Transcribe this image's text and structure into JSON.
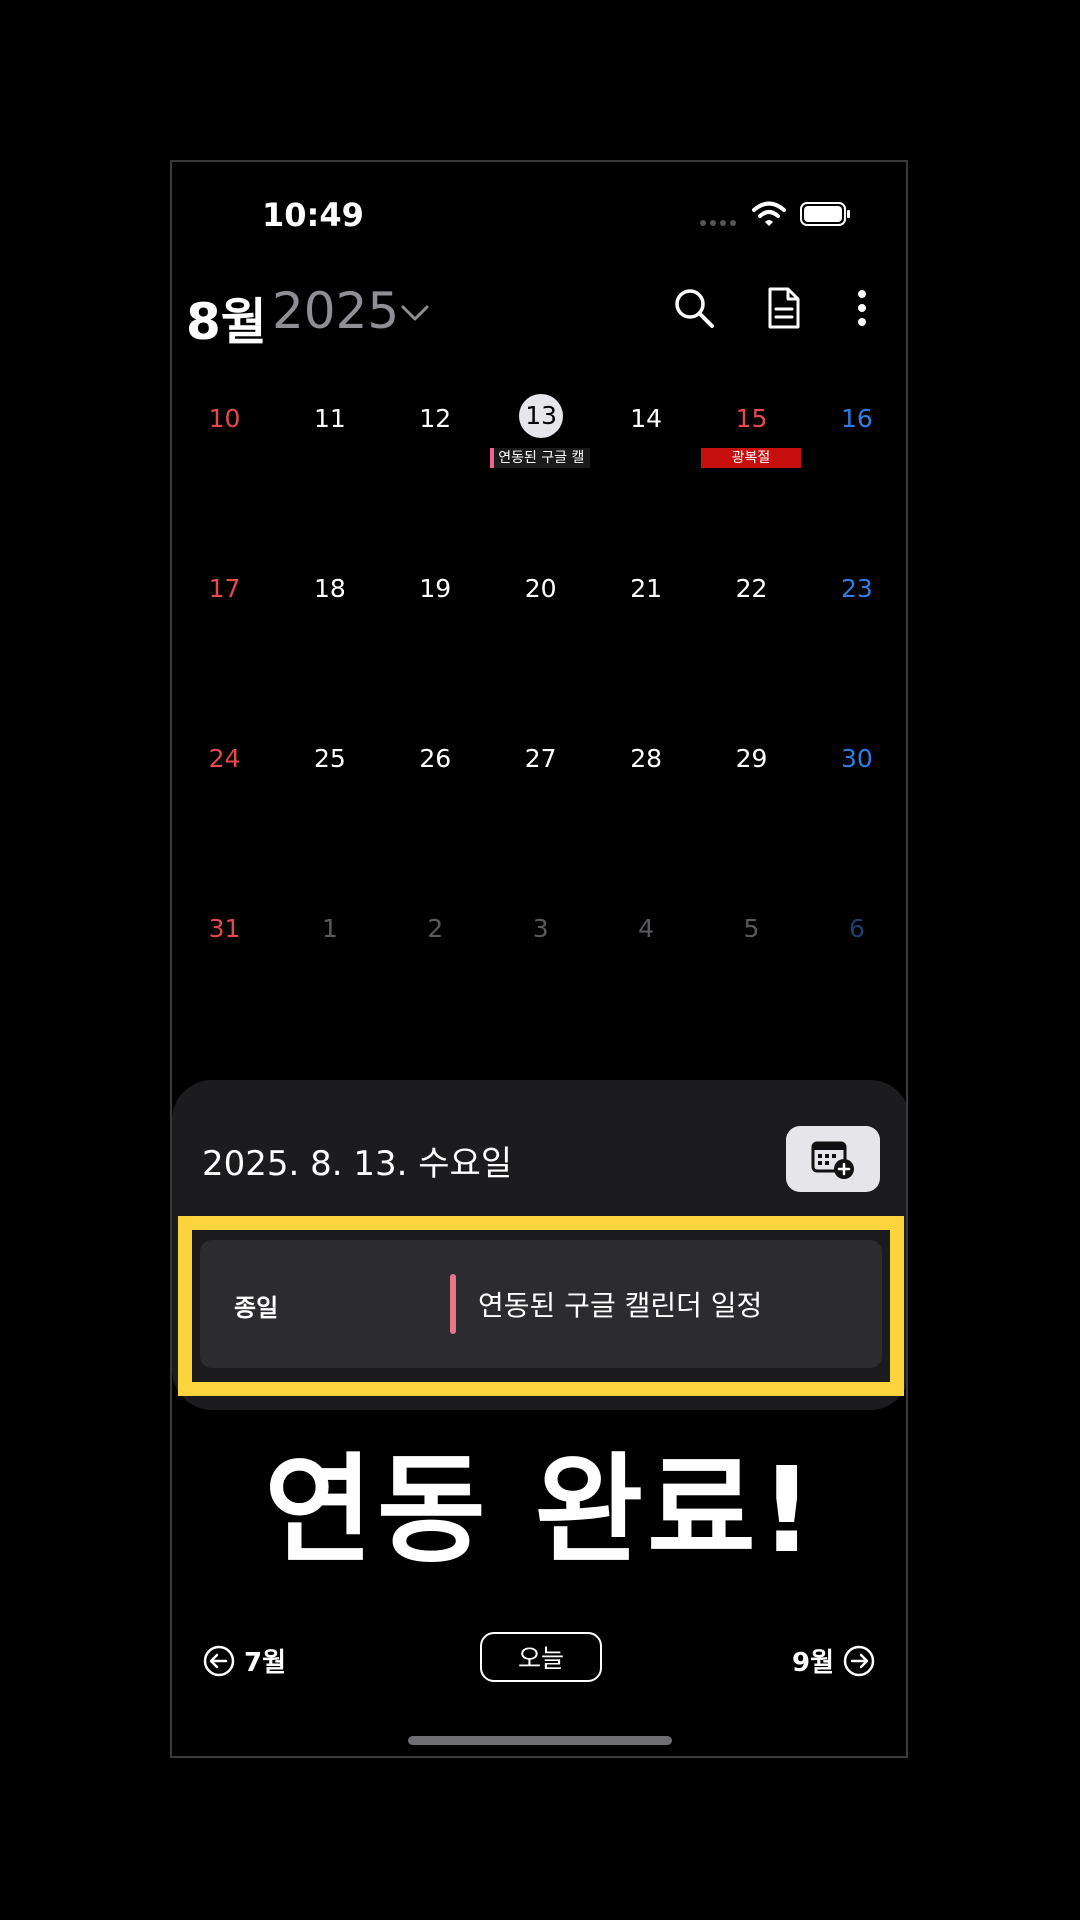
{
  "status": {
    "time": "10:49"
  },
  "header": {
    "month": "8월",
    "year": "2025"
  },
  "colors": {
    "sunday": "#e5484d",
    "saturday": "#2f7de1",
    "weekday": "#ffffff",
    "other_weekday": "#5a5a5e",
    "other_saturday": "#1f3f6e",
    "highlight": "#fdd43e",
    "holiday": "#c80f0f",
    "google_event": "#e8758a"
  },
  "calendar": {
    "weeks": [
      [
        {
          "d": "10",
          "t": "sun"
        },
        {
          "d": "11",
          "t": "wk"
        },
        {
          "d": "12",
          "t": "wk"
        },
        {
          "d": "13",
          "t": "wk",
          "today": true,
          "event": {
            "kind": "google",
            "label": "연동된 구글 캘"
          }
        },
        {
          "d": "14",
          "t": "wk"
        },
        {
          "d": "15",
          "t": "sun",
          "event": {
            "kind": "holiday",
            "label": "광복절"
          }
        },
        {
          "d": "16",
          "t": "sat"
        }
      ],
      [
        {
          "d": "17",
          "t": "sun"
        },
        {
          "d": "18",
          "t": "wk"
        },
        {
          "d": "19",
          "t": "wk"
        },
        {
          "d": "20",
          "t": "wk"
        },
        {
          "d": "21",
          "t": "wk"
        },
        {
          "d": "22",
          "t": "wk"
        },
        {
          "d": "23",
          "t": "sat"
        }
      ],
      [
        {
          "d": "24",
          "t": "sun"
        },
        {
          "d": "25",
          "t": "wk"
        },
        {
          "d": "26",
          "t": "wk"
        },
        {
          "d": "27",
          "t": "wk"
        },
        {
          "d": "28",
          "t": "wk"
        },
        {
          "d": "29",
          "t": "wk"
        },
        {
          "d": "30",
          "t": "sat"
        }
      ],
      [
        {
          "d": "31",
          "t": "sun"
        },
        {
          "d": "1",
          "t": "owk"
        },
        {
          "d": "2",
          "t": "owk"
        },
        {
          "d": "3",
          "t": "owk"
        },
        {
          "d": "4",
          "t": "owk"
        },
        {
          "d": "5",
          "t": "owk"
        },
        {
          "d": "6",
          "t": "osat"
        }
      ]
    ]
  },
  "sheet": {
    "date": "2025. 8. 13. 수요일",
    "event": {
      "allday": "종일",
      "title": "연동된 구글 캘린더 일정"
    }
  },
  "banner": "연동 완료!",
  "nav": {
    "prev": "7월",
    "today": "오늘",
    "next": "9월"
  }
}
